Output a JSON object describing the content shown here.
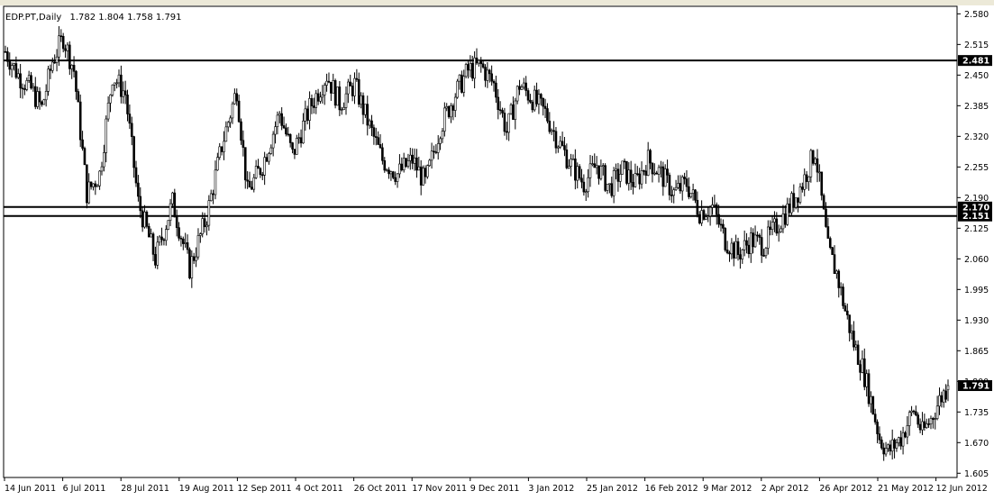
{
  "window": {
    "symbol": "EDP.PT,Daily",
    "ohlc": "1.782 1.804 1.758 1.791"
  },
  "chart_data": {
    "type": "candlestick",
    "title": "EDP.PT,Daily  1.782 1.804 1.758 1.791",
    "ylim": [
      1.596,
      2.596
    ],
    "y_ticks": [
      "2.580",
      "2.515",
      "2.450",
      "2.385",
      "2.320",
      "2.255",
      "2.190",
      "2.125",
      "2.060",
      "1.995",
      "1.930",
      "1.865",
      "1.800",
      "1.735",
      "1.670",
      "1.605"
    ],
    "x_ticks": [
      "14 Jun 2011",
      "6 Jul 2011",
      "28 Jul 2011",
      "19 Aug 2011",
      "12 Sep 2011",
      "4 Oct 2011",
      "26 Oct 2011",
      "17 Nov 2011",
      "9 Dec 2011",
      "3 Jan 2012",
      "25 Jan 2012",
      "16 Feb 2012",
      "9 Mar 2012",
      "2 Apr 2012",
      "26 Apr 2012",
      "21 May 2012",
      "12 Jun 2012"
    ],
    "levels": [
      {
        "label": "2.481",
        "value": 2.481
      },
      {
        "label": "2.170",
        "value": 2.17
      },
      {
        "label": "2.151",
        "value": 2.151
      }
    ],
    "last_price": {
      "label": "1.791",
      "value": 1.791
    },
    "last_bar": {
      "open": 1.782,
      "high": 1.804,
      "low": 1.758,
      "close": 1.791
    },
    "anchors": [
      [
        0,
        2.5
      ],
      [
        6,
        2.45
      ],
      [
        12,
        2.42
      ],
      [
        17,
        2.38
      ],
      [
        22,
        2.48
      ],
      [
        27,
        2.53
      ],
      [
        32,
        2.46
      ],
      [
        38,
        2.2
      ],
      [
        44,
        2.24
      ],
      [
        50,
        2.45
      ],
      [
        56,
        2.41
      ],
      [
        62,
        2.18
      ],
      [
        70,
        2.06
      ],
      [
        78,
        2.18
      ],
      [
        86,
        2.04
      ],
      [
        94,
        2.15
      ],
      [
        101,
        2.3
      ],
      [
        108,
        2.42
      ],
      [
        113,
        2.2
      ],
      [
        120,
        2.26
      ],
      [
        128,
        2.37
      ],
      [
        134,
        2.28
      ],
      [
        142,
        2.38
      ],
      [
        150,
        2.45
      ],
      [
        156,
        2.39
      ],
      [
        163,
        2.43
      ],
      [
        170,
        2.34
      ],
      [
        176,
        2.27
      ],
      [
        183,
        2.24
      ],
      [
        190,
        2.27
      ],
      [
        196,
        2.22
      ],
      [
        203,
        2.34
      ],
      [
        210,
        2.41
      ],
      [
        216,
        2.46
      ],
      [
        222,
        2.47
      ],
      [
        228,
        2.43
      ],
      [
        234,
        2.33
      ],
      [
        240,
        2.43
      ],
      [
        246,
        2.4
      ],
      [
        252,
        2.37
      ],
      [
        258,
        2.31
      ],
      [
        264,
        2.26
      ],
      [
        270,
        2.22
      ],
      [
        276,
        2.26
      ],
      [
        282,
        2.21
      ],
      [
        288,
        2.25
      ],
      [
        294,
        2.22
      ],
      [
        300,
        2.27
      ],
      [
        306,
        2.24
      ],
      [
        312,
        2.2
      ],
      [
        318,
        2.22
      ],
      [
        324,
        2.16
      ],
      [
        330,
        2.17
      ],
      [
        336,
        2.1
      ],
      [
        342,
        2.07
      ],
      [
        348,
        2.1
      ],
      [
        354,
        2.09
      ],
      [
        360,
        2.13
      ],
      [
        366,
        2.17
      ],
      [
        372,
        2.22
      ],
      [
        378,
        2.29
      ],
      [
        384,
        2.08
      ],
      [
        388,
        2.03
      ],
      [
        392,
        1.95
      ],
      [
        396,
        1.88
      ],
      [
        400,
        1.83
      ],
      [
        404,
        1.76
      ],
      [
        408,
        1.68
      ],
      [
        412,
        1.65
      ],
      [
        418,
        1.68
      ],
      [
        424,
        1.74
      ],
      [
        428,
        1.69
      ],
      [
        432,
        1.72
      ],
      [
        436,
        1.76
      ],
      [
        440,
        1.79
      ]
    ]
  }
}
